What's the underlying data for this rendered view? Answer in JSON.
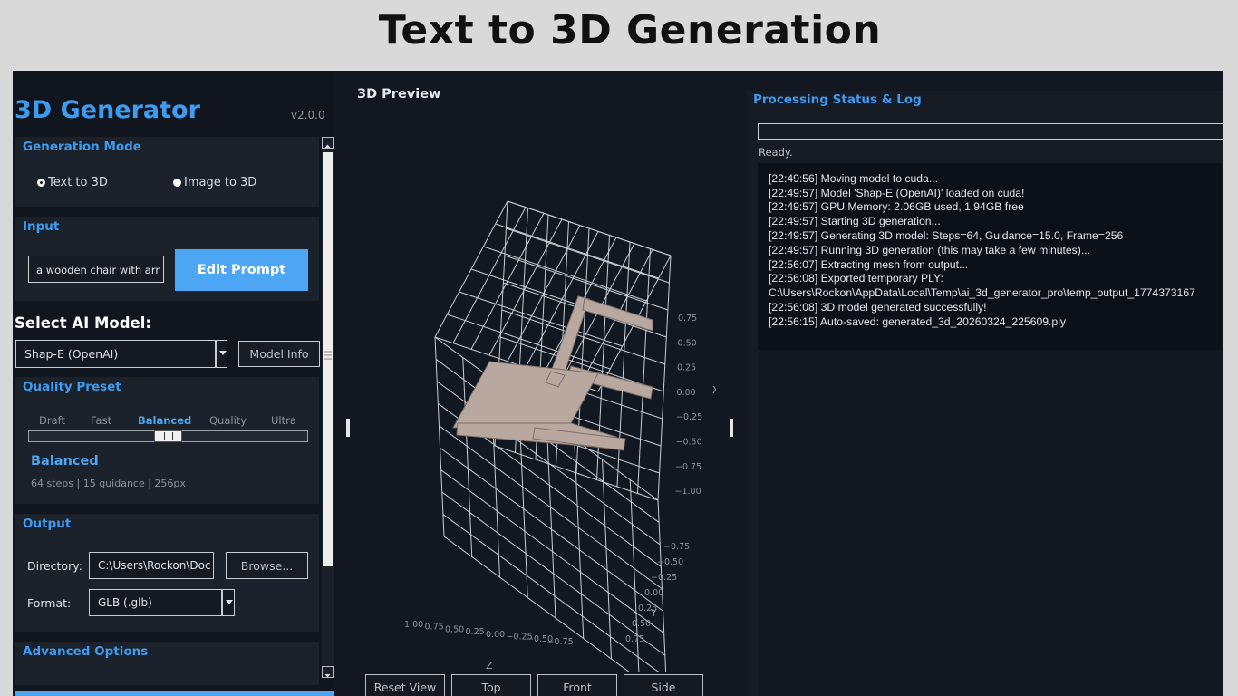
{
  "banner": {
    "title": "Text to 3D Generation"
  },
  "app": {
    "title": "3D Generator",
    "version": "v2.0.0"
  },
  "generation_mode": {
    "heading": "Generation Mode",
    "options": [
      {
        "label": "Text to 3D",
        "selected": true
      },
      {
        "label": "Image to 3D",
        "selected": false
      }
    ]
  },
  "input": {
    "heading": "Input",
    "prompt_value": "a wooden chair with arr",
    "edit_button": "Edit Prompt"
  },
  "model": {
    "heading": "Select AI Model:",
    "selected": "Shap-E (OpenAI)",
    "info_button": "Model Info"
  },
  "quality": {
    "heading": "Quality Preset",
    "presets": [
      "Draft",
      "Fast",
      "Balanced",
      "Quality",
      "Ultra"
    ],
    "selected_index": 2,
    "selected_name": "Balanced",
    "description": "64 steps  |  15 guidance  |  256px"
  },
  "output": {
    "heading": "Output",
    "directory_label": "Directory:",
    "directory_value": "C:\\Users\\Rockon\\Doc",
    "browse_button": "Browse...",
    "format_label": "Format:",
    "format_value": "GLB (.glb)"
  },
  "advanced": {
    "heading": "Advanced Options"
  },
  "preview": {
    "heading": "3D Preview",
    "axis_labels": {
      "x": "X",
      "y": "Y",
      "z": "Z"
    },
    "x_ticks": [
      "0.75",
      "0.50",
      "0.25",
      "0.00",
      "−0.25",
      "−0.50",
      "−0.75",
      "−1.00"
    ],
    "y_ticks": [
      "−0.75",
      "−0.50",
      "−0.25",
      "0.00",
      "0.25",
      "0.50",
      "0.75"
    ],
    "z_ticks": [
      "1.00",
      "0.75",
      "0.50",
      "0.25",
      "0.00",
      "−0.25",
      "−0.50",
      "−0.75"
    ],
    "view_buttons": [
      "Reset View",
      "Top",
      "Front",
      "Side"
    ]
  },
  "status": {
    "heading": "Processing Status & Log",
    "progress": 0,
    "text": "Ready.",
    "log": [
      "[22:49:56] Moving model to cuda...",
      "[22:49:57] Model 'Shap-E (OpenAI)' loaded on cuda!",
      "[22:49:57] GPU Memory: 2.06GB used, 1.94GB free",
      "[22:49:57] Starting 3D generation...",
      "[22:49:57] Generating 3D model: Steps=64, Guidance=15.0, Frame=256",
      "[22:49:57] Running 3D generation (this may take a few minutes)...",
      "[22:56:07] Extracting mesh from output...",
      "[22:56:08] Exported temporary PLY:",
      "C:\\Users\\Rockon\\AppData\\Local\\Temp\\ai_3d_generator_pro\\temp_output_1774373167",
      "[22:56:08] 3D model generated successfully!",
      "[22:56:15] Auto-saved: generated_3d_20260324_225609.ply"
    ]
  },
  "colors": {
    "accent": "#3d9bf0",
    "button": "#4ca6f3",
    "background": "#121722",
    "chair": "#b8a8a0"
  }
}
